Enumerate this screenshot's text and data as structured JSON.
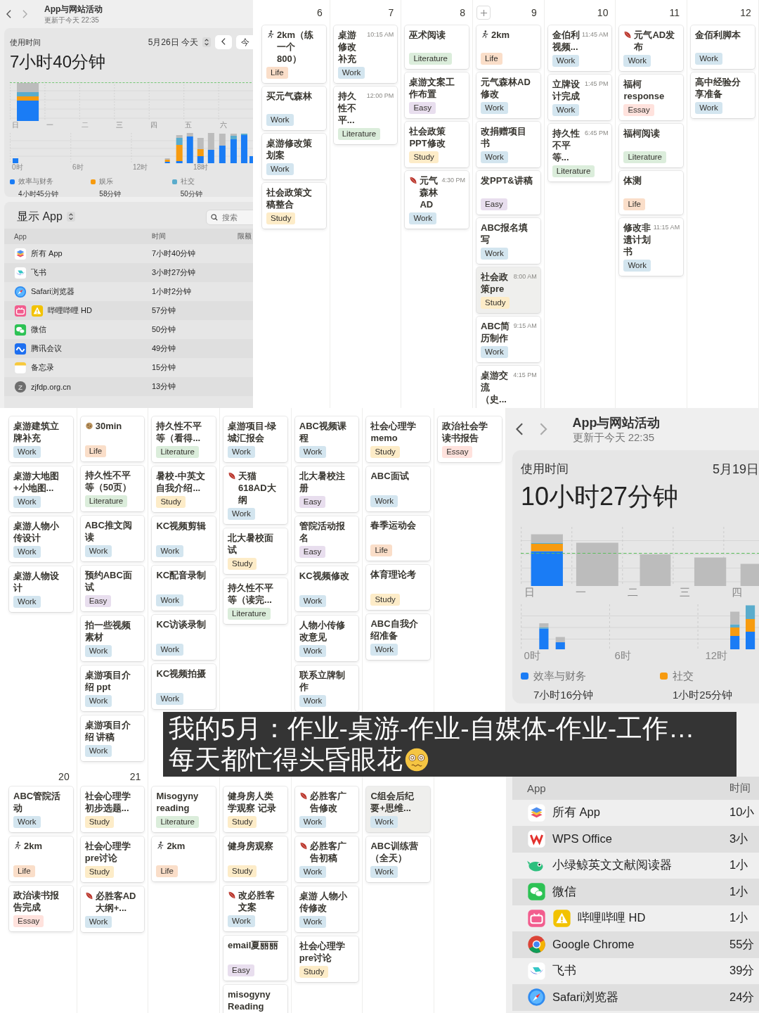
{
  "screen_time_panels": [
    {
      "title": "App与网站活动",
      "updated": "更新于今天 22:35",
      "usage_label": "使用时间",
      "date": "5月26日 今天",
      "today_button": "今",
      "total": "7小时40分钟",
      "day_labels": [
        "日",
        "一",
        "二",
        "三",
        "四",
        "五",
        "六"
      ],
      "hour_labels": [
        "0时",
        "6时",
        "12时",
        "18时"
      ],
      "legend": [
        {
          "name": "效率与财务",
          "value": "4小时45分钟",
          "color": "#1a7cf5"
        },
        {
          "name": "娱乐",
          "value": "58分钟",
          "color": "#f79b0f"
        },
        {
          "name": "社交",
          "value": "50分钟",
          "color": "#5aaccc"
        }
      ],
      "show_menu": "显示 App",
      "search_placeholder": "搜索",
      "columns": [
        "App",
        "时间",
        "限额"
      ],
      "apps": [
        {
          "kind": "stack",
          "name": "所有 App",
          "time": "7小时40分钟",
          "warning": false
        },
        {
          "kind": "bird",
          "name": "飞书",
          "time": "3小时27分钟",
          "warning": false
        },
        {
          "kind": "compass",
          "name": "Safari浏览器",
          "time": "1小时2分钟",
          "warning": false
        },
        {
          "kind": "tv",
          "name": "哔哩哔哩 HD",
          "time": "57分钟",
          "warning": true
        },
        {
          "kind": "chat",
          "name": "微信",
          "time": "50分钟",
          "warning": false
        },
        {
          "kind": "cloud",
          "name": "腾讯会议",
          "time": "49分钟",
          "warning": false
        },
        {
          "kind": "notepad",
          "name": "备忘录",
          "time": "15分钟",
          "warning": false
        },
        {
          "kind": "letter",
          "letter": "Z",
          "name": "zjfdp.org.cn",
          "time": "13分钟",
          "warning": false
        }
      ]
    },
    {
      "title": "App与网站活动",
      "updated": "更新于今天 22:35",
      "usage_label": "使用时间",
      "date": "5月19日",
      "total": "10小时27分钟",
      "day_labels": [
        "日",
        "一",
        "二",
        "三",
        "四"
      ],
      "hour_labels": [
        "0时",
        "6时",
        "12时"
      ],
      "legend": [
        {
          "name": "效率与财务",
          "value": "7小时16分钟",
          "color": "#1a7cf5"
        },
        {
          "name": "社交",
          "value": "1小时25分钟",
          "color": "#f79b0f"
        }
      ],
      "columns": [
        "App",
        "时间"
      ],
      "apps": [
        {
          "kind": "stack",
          "name": "所有 App",
          "time": "10小",
          "warning": false
        },
        {
          "kind": "zigzag",
          "name": "WPS Office",
          "time": "3小",
          "warning": false
        },
        {
          "kind": "whale",
          "name": "小绿鲸英文文献阅读器",
          "time": "1小",
          "warning": false
        },
        {
          "kind": "chat",
          "name": "微信",
          "time": "1小",
          "warning": false
        },
        {
          "kind": "tv",
          "name": "哔哩哔哩 HD",
          "time": "1小",
          "warning": true
        },
        {
          "kind": "chrome",
          "name": "Google Chrome",
          "time": "55分",
          "warning": false
        },
        {
          "kind": "bird",
          "name": "飞书",
          "time": "39分",
          "warning": false
        },
        {
          "kind": "compass",
          "name": "Safari浏览器",
          "time": "24分",
          "warning": false
        }
      ]
    }
  ],
  "calendars": [
    {
      "weeks": [
        {
          "days": [
            {
              "number": "6",
              "add_button": false,
              "cards": [
                {
                  "kind": "runner",
                  "title": "2km（练一个800）",
                  "tag": "Life",
                  "color": "#fadec9",
                  "highlighted": false
                },
                {
                  "title": "买元气森林",
                  "tag": "Work",
                  "color": "#d3e5ef",
                  "highlighted": false
                },
                {
                  "title": "桌游修改策划案",
                  "tag": "Work",
                  "color": "#d3e5ef",
                  "highlighted": false
                },
                {
                  "title": "社会政策文稿整合",
                  "tag": "Study",
                  "color": "#fdecc8",
                  "highlighted": false
                }
              ]
            },
            {
              "number": "7",
              "add_button": false,
              "cards": [
                {
                  "title": "桌游修改补充",
                  "time": "10:15 AM",
                  "tag": "Work",
                  "color": "#d3e5ef",
                  "highlighted": false
                },
                {
                  "title": "持久性不平...",
                  "time": "12:00 PM",
                  "tag": "Literature",
                  "color": "#dbeddb",
                  "highlighted": false
                }
              ]
            },
            {
              "number": "8",
              "add_button": false,
              "cards": [
                {
                  "title": "巫术阅读",
                  "tag": "Literature",
                  "color": "#dbeddb",
                  "highlighted": false
                },
                {
                  "title": "桌游文案工作布置",
                  "tag": "Easy",
                  "color": "#e8deee",
                  "highlighted": false
                },
                {
                  "title": "社会政策PPT修改",
                  "tag": "Study",
                  "color": "#fdecc8",
                  "highlighted": false
                },
                {
                  "kind": "leaf",
                  "title": "元气森林AD",
                  "time": "4:30 PM",
                  "tag": "Work",
                  "color": "#d3e5ef",
                  "highlighted": false
                }
              ]
            },
            {
              "number": "9",
              "add_button": true,
              "cards": [
                {
                  "kind": "runner",
                  "title": "2km",
                  "tag": "Life",
                  "color": "#fadec9",
                  "highlighted": false
                },
                {
                  "title": "元气森林AD修改",
                  "tag": "Work",
                  "color": "#d3e5ef",
                  "highlighted": false
                },
                {
                  "title": "改捐赠项目书",
                  "tag": "Work",
                  "color": "#d3e5ef",
                  "highlighted": false
                },
                {
                  "title": "发PPT&讲稿",
                  "tag": "Easy",
                  "color": "#e8deee",
                  "highlighted": false
                },
                {
                  "title": "ABC报名填写",
                  "tag": "Work",
                  "color": "#d3e5ef",
                  "highlighted": false
                },
                {
                  "title": "社会政策pre",
                  "time": "8:00 AM",
                  "tag": "Study",
                  "color": "#fdecc8",
                  "highlighted": true
                },
                {
                  "title": "ABC简历制作",
                  "time": "9:15 AM",
                  "tag": "Work",
                  "color": "#d3e5ef",
                  "highlighted": false
                },
                {
                  "title": "桌游交流（史...",
                  "time": "4:15 PM",
                  "highlighted": false
                }
              ]
            },
            {
              "number": "10",
              "add_button": false,
              "cards": [
                {
                  "title": "金伯利视频...",
                  "time": "11:45 AM",
                  "tag": "Work",
                  "color": "#d3e5ef",
                  "highlighted": false
                },
                {
                  "title": "立牌设计完成",
                  "time": "1:45 PM",
                  "tag": "Work",
                  "color": "#d3e5ef",
                  "highlighted": false
                },
                {
                  "title": "持久性不平等...",
                  "time": "6:45 PM",
                  "tag": "Literature",
                  "color": "#dbeddb",
                  "highlighted": false
                }
              ]
            },
            {
              "number": "11",
              "add_button": false,
              "cards": [
                {
                  "kind": "leaf",
                  "title": "元气AD发布",
                  "tag": "Work",
                  "color": "#d3e5ef",
                  "highlighted": false
                },
                {
                  "title": "福柯response",
                  "tag": "Essay",
                  "color": "#ffe2dd",
                  "highlighted": false
                },
                {
                  "title": "福柯阅读",
                  "tag": "Literature",
                  "color": "#dbeddb",
                  "highlighted": false
                },
                {
                  "title": "体测",
                  "tag": "Life",
                  "color": "#fadec9",
                  "highlighted": false
                },
                {
                  "title": "修改非遗计划书",
                  "time": "11:15 AM",
                  "tag": "Work",
                  "color": "#d3e5ef",
                  "highlighted": false
                }
              ]
            },
            {
              "number": "12",
              "add_button": false,
              "cards": [
                {
                  "title": "金佰利脚本",
                  "tag": "Work",
                  "color": "#d3e5ef",
                  "highlighted": false
                },
                {
                  "title": "高中经验分享准备",
                  "tag": "Work",
                  "color": "#d3e5ef",
                  "highlighted": false
                }
              ]
            }
          ]
        }
      ]
    },
    {
      "weeks": [
        {
          "days": [
            {
              "cards": [
                {
                  "title": "桌游建筑立牌补充",
                  "tag": "Work",
                  "color": "#d3e5ef",
                  "highlighted": false
                },
                {
                  "title": "桌游大地图+小地图...",
                  "tag": "Work",
                  "color": "#d3e5ef",
                  "highlighted": false
                },
                {
                  "title": "桌游人物小传设计",
                  "tag": "Work",
                  "color": "#d3e5ef",
                  "highlighted": false
                },
                {
                  "title": "桌游人物设计",
                  "tag": "Work",
                  "color": "#d3e5ef",
                  "highlighted": false
                }
              ]
            },
            {
              "cards": [
                {
                  "kind": "cookie",
                  "title": "30min",
                  "tag": "Life",
                  "color": "#fadec9",
                  "highlighted": false
                },
                {
                  "title": "持久性不平等（50页）",
                  "tag": "Literature",
                  "color": "#dbeddb",
                  "highlighted": false
                },
                {
                  "title": "ABC推文阅读",
                  "tag": "Work",
                  "color": "#d3e5ef",
                  "highlighted": false
                },
                {
                  "title": "预约ABC面试",
                  "tag": "Easy",
                  "color": "#e8deee",
                  "highlighted": false
                },
                {
                  "title": "拍一些视频素材",
                  "tag": "Work",
                  "color": "#d3e5ef",
                  "highlighted": false
                },
                {
                  "title": "桌游项目介绍 ppt",
                  "tag": "Work",
                  "color": "#d3e5ef",
                  "highlighted": false
                },
                {
                  "title": "桌游项目介绍 讲稿",
                  "tag": "Work",
                  "color": "#d3e5ef",
                  "highlighted": false
                }
              ]
            },
            {
              "cards": [
                {
                  "title": "持久性不平等（看得...",
                  "tag": "Literature",
                  "color": "#dbeddb",
                  "highlighted": false
                },
                {
                  "title": "暑校-中英文自我介绍...",
                  "tag": "Study",
                  "color": "#fdecc8",
                  "highlighted": false
                },
                {
                  "title": "KC视频剪辑",
                  "tag": "Work",
                  "color": "#d3e5ef",
                  "highlighted": false
                },
                {
                  "title": "KC配音录制",
                  "tag": "Work",
                  "color": "#d3e5ef",
                  "highlighted": false
                },
                {
                  "title": "KC访谈录制",
                  "tag": "Work",
                  "color": "#d3e5ef",
                  "highlighted": false
                },
                {
                  "title": "KC视频拍摄",
                  "tag": "Work",
                  "color": "#d3e5ef",
                  "highlighted": false
                }
              ]
            },
            {
              "cards": [
                {
                  "title": "桌游项目-绿城汇报会",
                  "tag": "Work",
                  "color": "#d3e5ef",
                  "highlighted": false
                },
                {
                  "kind": "leaf",
                  "title": "天猫618AD大纲",
                  "tag": "Work",
                  "color": "#d3e5ef",
                  "highlighted": false
                },
                {
                  "title": "北大暑校面试",
                  "tag": "Study",
                  "color": "#fdecc8",
                  "highlighted": false
                },
                {
                  "title": "持久性不平等（读完...",
                  "tag": "Literature",
                  "color": "#dbeddb",
                  "highlighted": false
                }
              ]
            },
            {
              "cards": [
                {
                  "title": "ABC视频课程",
                  "tag": "Work",
                  "color": "#d3e5ef",
                  "highlighted": false
                },
                {
                  "title": "北大暑校注册",
                  "tag": "Easy",
                  "color": "#e8deee",
                  "highlighted": false
                },
                {
                  "title": "管院活动报名",
                  "tag": "Easy",
                  "color": "#e8deee",
                  "highlighted": false
                },
                {
                  "title": "KC视频修改",
                  "tag": "Work",
                  "color": "#d3e5ef",
                  "highlighted": false
                },
                {
                  "title": "人物小传修改意见",
                  "tag": "Work",
                  "color": "#d3e5ef",
                  "highlighted": false
                },
                {
                  "title": "联系立牌制作",
                  "tag": "Work",
                  "color": "#d3e5ef",
                  "highlighted": false
                }
              ]
            },
            {
              "cards": [
                {
                  "title": "社会心理学memo",
                  "tag": "Study",
                  "color": "#fdecc8",
                  "highlighted": false
                },
                {
                  "title": "ABC面试",
                  "tag": "Work",
                  "color": "#d3e5ef",
                  "highlighted": false
                },
                {
                  "title": "春季运动会",
                  "tag": "Life",
                  "color": "#fadec9",
                  "highlighted": false
                },
                {
                  "title": "体育理论考",
                  "tag": "Study",
                  "color": "#fdecc8",
                  "highlighted": false
                },
                {
                  "title": "ABC自我介绍准备",
                  "tag": "Work",
                  "color": "#d3e5ef",
                  "highlighted": false
                }
              ]
            },
            {
              "cards": [
                {
                  "title": "政治社会学读书报告",
                  "tag": "Essay",
                  "color": "#ffe2dd",
                  "highlighted": false
                }
              ]
            }
          ]
        },
        {
          "days": [
            {
              "number": "20",
              "cards": [
                {
                  "title": "ABC管院活动",
                  "tag": "Work",
                  "color": "#d3e5ef",
                  "highlighted": false
                },
                {
                  "kind": "runner",
                  "title": "2km",
                  "tag": "Life",
                  "color": "#fadec9",
                  "highlighted": false
                },
                {
                  "title": "政治读书报告完成",
                  "tag": "Essay",
                  "color": "#ffe2dd",
                  "highlighted": false
                }
              ]
            },
            {
              "number": "21",
              "cards": [
                {
                  "title": "社会心理学初步选题...",
                  "tag": "Study",
                  "color": "#fdecc8",
                  "highlighted": false
                },
                {
                  "title": "社会心理学pre讨论",
                  "tag": "Study",
                  "color": "#fdecc8",
                  "highlighted": false
                },
                {
                  "kind": "leaf",
                  "title": "必胜客AD大纲+...",
                  "tag": "Work",
                  "color": "#d3e5ef",
                  "highlighted": false
                }
              ]
            },
            {
              "cards": [
                {
                  "title": "Misogyny reading",
                  "tag": "Literature",
                  "color": "#dbeddb",
                  "highlighted": false
                },
                {
                  "kind": "runner",
                  "title": "2km",
                  "tag": "Life",
                  "color": "#fadec9",
                  "highlighted": false
                }
              ]
            },
            {
              "cards": [
                {
                  "title": "健身房人类学观察 记录",
                  "tag": "Study",
                  "color": "#fdecc8",
                  "highlighted": false
                },
                {
                  "title": "健身房观察",
                  "tag": "Study",
                  "color": "#fdecc8",
                  "highlighted": false
                },
                {
                  "kind": "leaf",
                  "title": "改必胜客文案",
                  "tag": "Work",
                  "color": "#d3e5ef",
                  "highlighted": false
                },
                {
                  "title": "email夏丽丽",
                  "tag": "Easy",
                  "color": "#e8deee",
                  "highlighted": false
                },
                {
                  "title": "misogyny Reading",
                  "highlighted": false
                }
              ]
            },
            {
              "cards": [
                {
                  "kind": "leaf",
                  "title": "必胜客广告修改",
                  "tag": "Work",
                  "color": "#d3e5ef",
                  "highlighted": false
                },
                {
                  "kind": "leaf",
                  "title": "必胜客广告初稿",
                  "tag": "Work",
                  "color": "#d3e5ef",
                  "highlighted": false
                },
                {
                  "title": "桌游 人物小传修改",
                  "tag": "Work",
                  "color": "#d3e5ef",
                  "highlighted": false
                },
                {
                  "title": "社会心理学pre讨论",
                  "tag": "Study",
                  "color": "#fdecc8",
                  "highlighted": false
                }
              ]
            },
            {
              "cards": [
                {
                  "title": "C组会后纪要+思维...",
                  "tag": "Work",
                  "color": "#d3e5ef",
                  "highlighted": true
                },
                {
                  "title": "ABC训练营（全天）",
                  "tag": "Work",
                  "color": "#d3e5ef",
                  "highlighted": false
                }
              ]
            }
          ]
        }
      ]
    }
  ],
  "caption": {
    "lines": [
      "我的5月：作业-桌游-作业-自媒体-作业-工作…",
      "每天都忙得头昏眼花"
    ]
  }
}
